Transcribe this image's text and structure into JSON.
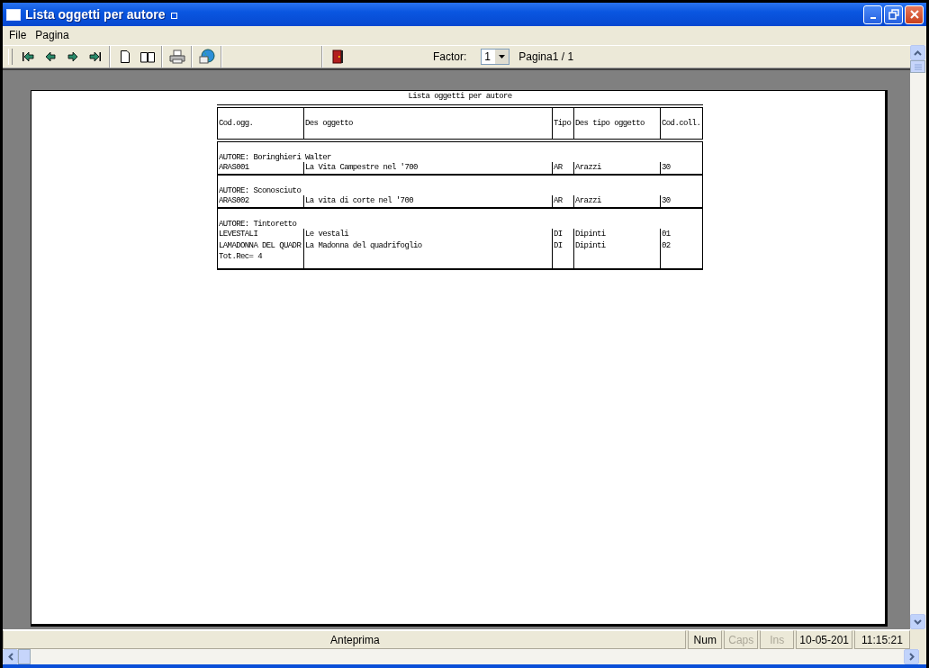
{
  "window": {
    "title": "Lista oggetti per autore"
  },
  "menu": [
    "File",
    "Pagina"
  ],
  "toolbar": {
    "factor_label": "Factor:",
    "factor_value": "1",
    "page_info": "Pagina1 / 1"
  },
  "report": {
    "title": "Lista oggetti per autore",
    "columns": [
      "Cod.ogg.",
      "Des oggetto",
      "Tipo",
      "Des tipo oggetto",
      "Cod.coll."
    ],
    "groups": [
      {
        "author": "AUTORE: Boringhieri Walter",
        "rows": [
          [
            "ARAS001",
            "La Vita Campestre nel '700",
            "AR",
            "Arazzi",
            "30"
          ]
        ]
      },
      {
        "author": "AUTORE: Sconosciuto",
        "rows": [
          [
            "ARAS002",
            "La vita di corte nel '700",
            "AR",
            "Arazzi",
            "30"
          ]
        ]
      },
      {
        "author": "AUTORE: Tintoretto",
        "rows": [
          [
            "LEVESTALI",
            "Le vestali",
            "DI",
            "Dipinti",
            "01"
          ],
          [
            "LAMADONNA DEL QUADR",
            "La Madonna del quadrifoglio",
            "DI",
            "Dipinti",
            "02"
          ]
        ]
      }
    ],
    "total": "Tot.Rec= 4"
  },
  "status_bar": {
    "message": "Anteprima",
    "indicators": [
      {
        "label": "Num",
        "disabled": false
      },
      {
        "label": "Caps",
        "disabled": true
      },
      {
        "label": "Ins",
        "disabled": true
      }
    ],
    "date": "10-05-201",
    "time": "11:15:21"
  }
}
